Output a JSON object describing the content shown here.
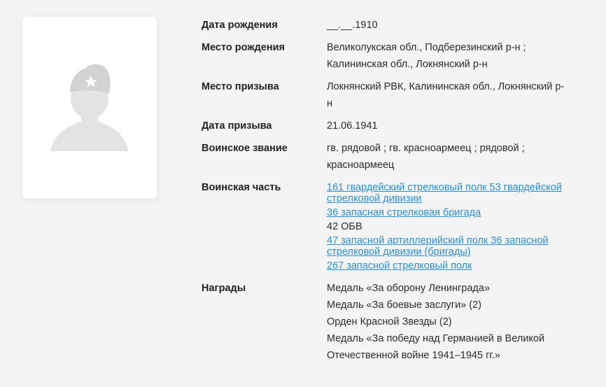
{
  "person": {
    "photo_alt": "soldier-silhouette"
  },
  "fields": {
    "birth_date": {
      "label": "Дата рождения",
      "value": "__.__.1910"
    },
    "birth_place": {
      "label": "Место рождения",
      "lines": [
        "Великолукская обл., Подберезинский р-н ;",
        "Калининская обл., Локнянский р-н"
      ]
    },
    "draft_place": {
      "label": "Место призыва",
      "lines": [
        "Локнянский РВК, Калининская обл., Локнянский р-",
        "н"
      ]
    },
    "draft_date": {
      "label": "Дата призыва",
      "value": "21.06.1941"
    },
    "rank": {
      "label": "Воинское звание",
      "lines": [
        "гв. рядовой ; гв. красноармеец ; рядовой ;",
        "красноармеец"
      ]
    },
    "unit": {
      "label": "Воинская часть",
      "items": [
        {
          "text": "161 гвардейский стрелковый полк 53 гвардейской стрелковой дивизии",
          "link": true
        },
        {
          "text": "36 запасная стрелковая бригада",
          "link": true
        },
        {
          "text": "42 ОБВ",
          "link": false
        },
        {
          "text": "47 запасной артиллерийский полк 36 запасной стрелковой дивизии (бригады)",
          "link": true
        },
        {
          "text": "267 запасной стрелковый полк",
          "link": true
        }
      ]
    },
    "awards": {
      "label": "Награды",
      "lines": [
        "Медаль «За оборону Ленинграда»",
        "Медаль «За боевые заслуги» (2)",
        "Орден Красной Звезды (2)",
        "Медаль «За победу над Германией в Великой",
        "Отечественной войне 1941–1945 гг.»"
      ]
    }
  },
  "colors": {
    "link": "#2a8fd6",
    "background": "#f4f4f4",
    "silhouette": "#e3e3e3"
  }
}
